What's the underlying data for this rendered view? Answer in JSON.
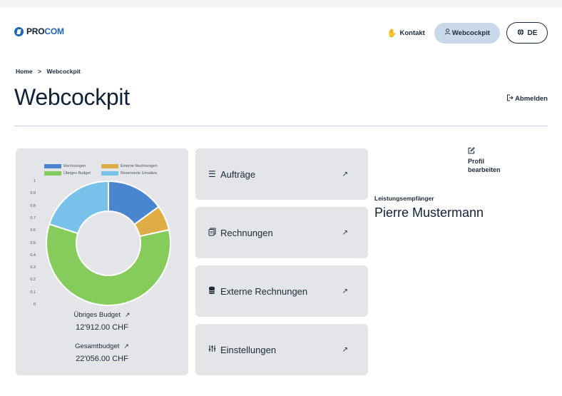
{
  "header": {
    "logo_prefix": "PRO",
    "logo_suffix": "COM",
    "contact_label": "Kontakt",
    "webcockpit_label": "Webcockpit",
    "language_label": "DE"
  },
  "breadcrumb": {
    "home": "Home",
    "separator": ">",
    "current": "Webcockpit"
  },
  "page_title": "Webcockpit",
  "logout_label": "Abmelden",
  "chart_data": {
    "type": "pie",
    "donut": true,
    "legend": [
      {
        "name": "Rechnungen",
        "color": "#4a86cf"
      },
      {
        "name": "Externe Rechnungen",
        "color": "#e0ac45"
      },
      {
        "name": "Übriges Budget",
        "color": "#86cc5c"
      },
      {
        "name": "Reservierte Umsätze",
        "color": "#77c1ea"
      }
    ],
    "values": [
      0.15,
      0.065,
      0.585,
      0.2
    ],
    "yaxis_ticks": [
      "1",
      "0.9",
      "0.8",
      "0.7",
      "0.6",
      "0.5",
      "0.4",
      "0.3",
      "0.2",
      "0.1",
      "0"
    ],
    "legend_position": "top"
  },
  "budget": {
    "remaining_label": "Übriges Budget",
    "remaining_value": "12'912.00 CHF",
    "total_label": "Gesamtbudget",
    "total_value": "22'056.00 CHF"
  },
  "tiles": [
    {
      "label": "Aufträge",
      "icon": "list-icon"
    },
    {
      "label": "Rechnungen",
      "icon": "documents-icon"
    },
    {
      "label": "Externe Rechnungen",
      "icon": "database-icon"
    },
    {
      "label": "Einstellungen",
      "icon": "sliders-icon"
    }
  ],
  "profile": {
    "edit_line1": "Profil",
    "edit_line2": "bearbeiten",
    "recipient_label": "Leistungsempfänger",
    "recipient_name": "Pierre Mustermann"
  }
}
